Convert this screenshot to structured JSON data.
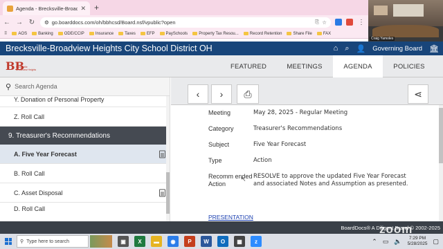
{
  "browser": {
    "tab_title": "Agenda - Brecksville-Broadvie",
    "url": "go.boarddocs.com/oh/bbhcsd/Board.nsf/vpublic?open",
    "bookmarks": [
      "AOS",
      "Banking",
      "ODE/CCIP",
      "Insurance",
      "Taxes",
      "EFP",
      "PaySchools",
      "Property Tax Resou...",
      "Record Retention",
      "Share File",
      "FAX"
    ]
  },
  "zoom": {
    "participant_name": "Craig Yamoles",
    "watermark": "zoom"
  },
  "site": {
    "title": "Brecksville-Broadview Heights City School District OH",
    "governing_board": "Governing Board",
    "logo_text": "Brecksville Broadview Heights",
    "nav": [
      "FEATURED",
      "MEETINGS",
      "AGENDA",
      "POLICIES"
    ],
    "active_tab": "AGENDA"
  },
  "left": {
    "search_placeholder": "Search Agenda",
    "items_before": [
      {
        "label": "Y. Donation of Personal Property"
      },
      {
        "label": "Z. Roll Call"
      }
    ],
    "section": "9. Treasurer's Recommendations",
    "items_after": [
      {
        "label": "A. Five Year Forecast",
        "selected": true,
        "doc_icon": true
      },
      {
        "label": "B. Roll Call",
        "selected": false,
        "doc_icon": false
      },
      {
        "label": "C. Asset Disposal",
        "selected": false,
        "doc_icon": true
      },
      {
        "label": "D. Roll Call",
        "selected": false,
        "doc_icon": false
      }
    ]
  },
  "detail": {
    "meeting_label": "Meeting",
    "meeting": "May 28, 2025 - Regular Meeting",
    "category_label": "Category",
    "category": "Treasurer's Recommendations",
    "subject_label": "Subject",
    "subject": "Five Year Forecast",
    "type_label": "Type",
    "type": "Action",
    "recommended_label": "Recomm ended Action",
    "recommended": "RESOLVE to approve the updated Five Year Forecast and associated Notes and Assumption as presented.",
    "link": "PRESENTATION"
  },
  "footer": {
    "text": "BoardDocs® A Diligent Brand © 2002-2025"
  },
  "taskbar": {
    "search_placeholder": "Type here to search",
    "time": "7:29 PM",
    "date": "5/28/2025"
  }
}
